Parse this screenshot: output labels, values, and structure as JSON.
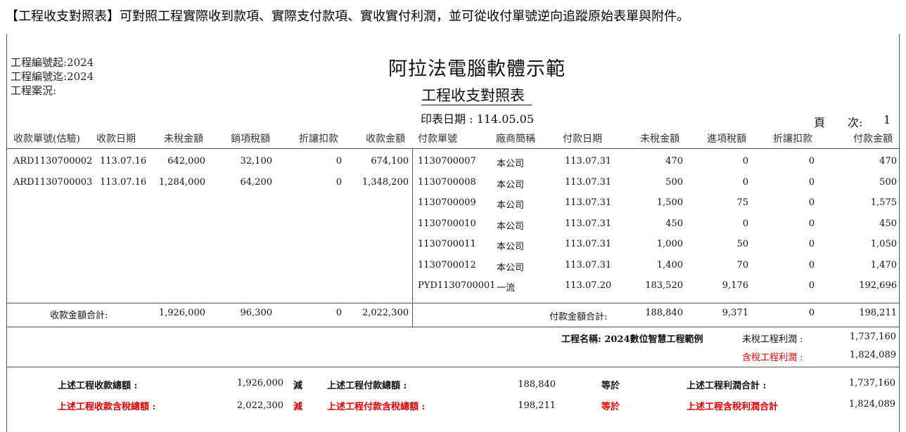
{
  "caption": "【工程收支對照表】可對照工程實際收到款項、實際支付款項、實收實付利潤，並可從收付單號逆向追蹤原始表單與附件。",
  "header": {
    "project_no_from": "工程編號起:2024",
    "project_no_to": "工程編號迄:2024",
    "project_status": "工程案況:",
    "company": "阿拉法電腦軟體示範",
    "title": "工程收支對照表",
    "print_date": "印表日期 : 114.05.05",
    "page_label": "頁　　次:",
    "page_number": "1"
  },
  "receipt_columns": [
    "收款單號(估驗)",
    "收款日期",
    "未稅金額",
    "銷項稅額",
    "折讓扣款",
    "收款金額"
  ],
  "payment_columns": [
    "付款單號",
    "廠商簡稱",
    "付款日期",
    "未稅金額",
    "進項稅額",
    "折讓扣款",
    "付款金額"
  ],
  "receipts": [
    {
      "no": "ARD1130700002",
      "date": "113.07.16",
      "untaxed": "642,000",
      "tax": "32,100",
      "discount": "0",
      "amount": "674,100"
    },
    {
      "no": "ARD1130700003",
      "date": "113.07.16",
      "untaxed": "1,284,000",
      "tax": "64,200",
      "discount": "0",
      "amount": "1,348,200"
    }
  ],
  "payments": [
    {
      "no": "1130700007",
      "vendor": "本公司",
      "date": "113.07.31",
      "untaxed": "470",
      "tax": "0",
      "discount": "0",
      "amount": "470"
    },
    {
      "no": "1130700008",
      "vendor": "本公司",
      "date": "113.07.31",
      "untaxed": "500",
      "tax": "0",
      "discount": "0",
      "amount": "500"
    },
    {
      "no": "1130700009",
      "vendor": "本公司",
      "date": "113.07.31",
      "untaxed": "1,500",
      "tax": "75",
      "discount": "0",
      "amount": "1,575"
    },
    {
      "no": "1130700010",
      "vendor": "本公司",
      "date": "113.07.31",
      "untaxed": "450",
      "tax": "0",
      "discount": "0",
      "amount": "450"
    },
    {
      "no": "1130700011",
      "vendor": "本公司",
      "date": "113.07.31",
      "untaxed": "1,000",
      "tax": "50",
      "discount": "0",
      "amount": "1,050"
    },
    {
      "no": "1130700012",
      "vendor": "本公司",
      "date": "113.07.31",
      "untaxed": "1,400",
      "tax": "70",
      "discount": "0",
      "amount": "1,470"
    },
    {
      "no": "PYD1130700001",
      "vendor": "一流",
      "date": "113.07.20",
      "untaxed": "183,520",
      "tax": "9,176",
      "discount": "0",
      "amount": "192,696"
    }
  ],
  "receipt_totals": {
    "label": "收款金額合計:",
    "untaxed": "1,926,000",
    "tax": "96,300",
    "discount": "0",
    "amount": "2,022,300"
  },
  "payment_totals": {
    "label": "付款金額合計:",
    "untaxed": "188,840",
    "tax": "9,371",
    "discount": "0",
    "amount": "198,211"
  },
  "project": {
    "name": "工程名稱: 2024數位智慧工程範例",
    "profit_untaxed_label": "未稅工程利潤 :",
    "profit_untaxed": "1,737,160",
    "profit_taxed_label": "含稅工程利潤 :",
    "profit_taxed": "1,824,089"
  },
  "summary": {
    "row1": {
      "label_a": "上述工程收款總額 :",
      "value_a": "1,926,000",
      "minus": "減",
      "label_b": "上述工程付款總額 :",
      "value_b": "188,840",
      "equals": "等於",
      "label_c": "上述工程利潤合計 :",
      "value_c": "1,737,160"
    },
    "row2": {
      "label_a": "上述工程收款含稅總額 :",
      "value_a": "2,022,300",
      "minus": "減",
      "label_b": "上述工程付款含稅總額 :",
      "value_b": "198,211",
      "equals": "等於",
      "label_c": "上述工程含稅利潤合計",
      "value_c": "1,824,089"
    }
  },
  "colors": {
    "red": "#e00000",
    "line": "#555555"
  }
}
